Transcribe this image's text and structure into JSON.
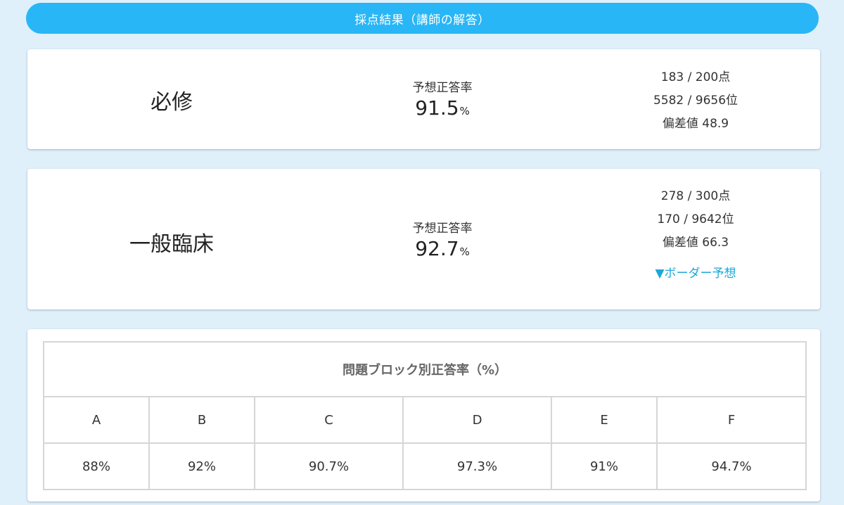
{
  "header": {
    "title": "採点結果（講師の解答）"
  },
  "hisshu": {
    "subject": "必修",
    "rate_label": "予想正答率",
    "rate_value": "91.5",
    "rate_unit": "%",
    "score": "183 / 200点",
    "rank": "5582 / 9656位",
    "deviation": "偏差値 48.9"
  },
  "ippan": {
    "subject": "一般臨床",
    "rate_label": "予想正答率",
    "rate_value": "92.7",
    "rate_unit": "%",
    "score": "278 / 300点",
    "rank": "170 / 9642位",
    "deviation": "偏差値 66.3",
    "border_link": "▼ボーダー予想"
  },
  "blocks": {
    "title": "問題ブロック別正答率（%）",
    "headers": [
      "A",
      "B",
      "C",
      "D",
      "E",
      "F"
    ],
    "values": [
      "88%",
      "92%",
      "90.7%",
      "97.3%",
      "91%",
      "94.7%"
    ]
  },
  "colors": {
    "background": "#dff0fb",
    "header_bar": "#29b6f6",
    "link": "#1ba8d8"
  }
}
